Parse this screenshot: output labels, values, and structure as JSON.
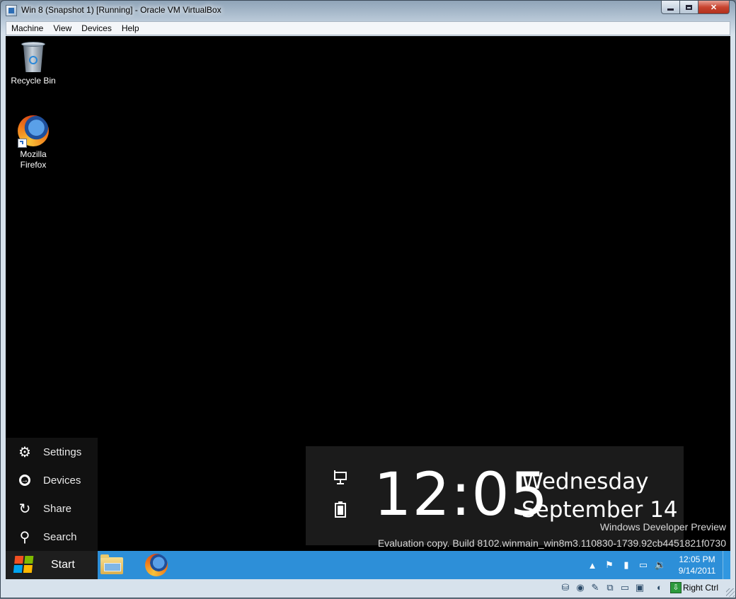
{
  "window": {
    "title": "Win 8 (Snapshot 1) [Running] - Oracle VM VirtualBox",
    "controls": {
      "minimize": "minimize",
      "maximize": "maximize",
      "close": "✕"
    }
  },
  "menubar": {
    "items": [
      "Machine",
      "View",
      "Devices",
      "Help"
    ]
  },
  "desktop": {
    "icons": [
      {
        "label": "Recycle Bin",
        "icon": "recycle-bin-icon"
      },
      {
        "label": "Mozilla Firefox",
        "icon": "firefox-icon"
      }
    ]
  },
  "charms": {
    "items": [
      {
        "label": "Settings",
        "icon": "gear-icon",
        "glyph": "⚙"
      },
      {
        "label": "Devices",
        "icon": "devices-icon",
        "glyph": "→"
      },
      {
        "label": "Share",
        "icon": "share-icon",
        "glyph": "↻"
      },
      {
        "label": "Search",
        "icon": "search-icon",
        "glyph": "⚲"
      }
    ]
  },
  "clock_overlay": {
    "time": "12:05",
    "day": "Wednesday",
    "date": "September 14",
    "status_icons": [
      "network-icon",
      "battery-icon"
    ]
  },
  "watermark": {
    "line1": "Windows Developer Preview",
    "line2": "Evaluation copy. Build 8102.winmain_win8m3.110830-1739.92cb4451821f0730"
  },
  "taskbar": {
    "start_label": "Start",
    "apps": [
      "file-explorer-icon",
      "firefox-icon"
    ],
    "tray": {
      "time": "12:05 PM",
      "date": "9/14/2011",
      "icons": [
        "show-hidden-icons",
        "action-center-flag-icon",
        "power-icon",
        "network-icon",
        "volume-icon"
      ]
    }
  },
  "vbox_status": {
    "host_key": "Right Ctrl",
    "icons": [
      "hard-disk-icon",
      "optical-drive-icon",
      "usb-icon",
      "network-adapters-icon",
      "shared-folders-icon",
      "video-capture-icon",
      "mouse-integration-icon"
    ]
  },
  "colors": {
    "taskbar": "#2d8fd8",
    "charms_bg": "#111111",
    "clock_bg": "#1b1b1b"
  }
}
